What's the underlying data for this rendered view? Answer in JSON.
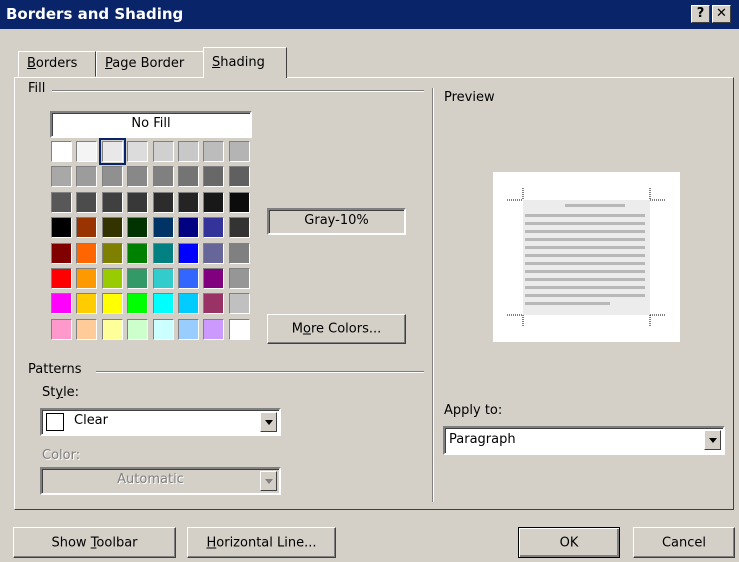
{
  "window": {
    "title": "Borders and Shading",
    "help_btn": "?",
    "close_btn": "✕"
  },
  "tabs": [
    {
      "label_pre": "",
      "label_key": "B",
      "label_post": "orders"
    },
    {
      "label_pre": "",
      "label_key": "P",
      "label_post": "age Border"
    },
    {
      "label_pre": "",
      "label_key": "S",
      "label_post": "hading"
    }
  ],
  "fill": {
    "label": "Fill",
    "no_fill": "No Fill",
    "selected_name": "Gray-10%",
    "more_colors_pre": "M",
    "more_colors_key": "o",
    "more_colors_post": "re Colors...",
    "palette": [
      [
        "#ffffff",
        "#f4f4f4",
        "#e8e8e8",
        "#dcdcdc",
        "#d0d0d0",
        "#c8c8c8",
        "#bcbcbc",
        "#b4b4b4"
      ],
      [
        "#a8a8a8",
        "#9c9c9c",
        "#909090",
        "#888888",
        "#808080",
        "#747474",
        "#686868",
        "#606060"
      ],
      [
        "#585858",
        "#4c4c4c",
        "#404040",
        "#383838",
        "#2c2c2c",
        "#242424",
        "#181818",
        "#0c0c0c"
      ],
      [
        "#000000",
        "#993300",
        "#333300",
        "#003300",
        "#003366",
        "#000080",
        "#333399",
        "#333333"
      ],
      [
        "#800000",
        "#ff6600",
        "#808000",
        "#008000",
        "#008080",
        "#0000ff",
        "#666699",
        "#808080"
      ],
      [
        "#ff0000",
        "#ff9900",
        "#99cc00",
        "#339966",
        "#33cccc",
        "#3366ff",
        "#800080",
        "#969696"
      ],
      [
        "#ff00ff",
        "#ffcc00",
        "#ffff00",
        "#00ff00",
        "#00ffff",
        "#00ccff",
        "#993366",
        "#c0c0c0"
      ],
      [
        "#ff99cc",
        "#ffcc99",
        "#ffff99",
        "#ccffcc",
        "#ccffff",
        "#99ccff",
        "#cc99ff",
        "#ffffff"
      ]
    ]
  },
  "patterns": {
    "label": "Patterns",
    "style_pre": "St",
    "style_key": "y",
    "style_post": "le:",
    "style_value": "Clear",
    "color_label": "Color:",
    "color_value": "Automatic"
  },
  "preview": {
    "label": "Preview",
    "apply_to_label": "Apply to:",
    "apply_to_value": "Paragraph"
  },
  "buttons": {
    "show_toolbar_pre": "Show ",
    "show_toolbar_key": "T",
    "show_toolbar_post": "oolbar",
    "horizontal_line_pre": "",
    "horizontal_line_key": "H",
    "horizontal_line_post": "orizontal Line...",
    "ok": "OK",
    "cancel": "Cancel"
  }
}
